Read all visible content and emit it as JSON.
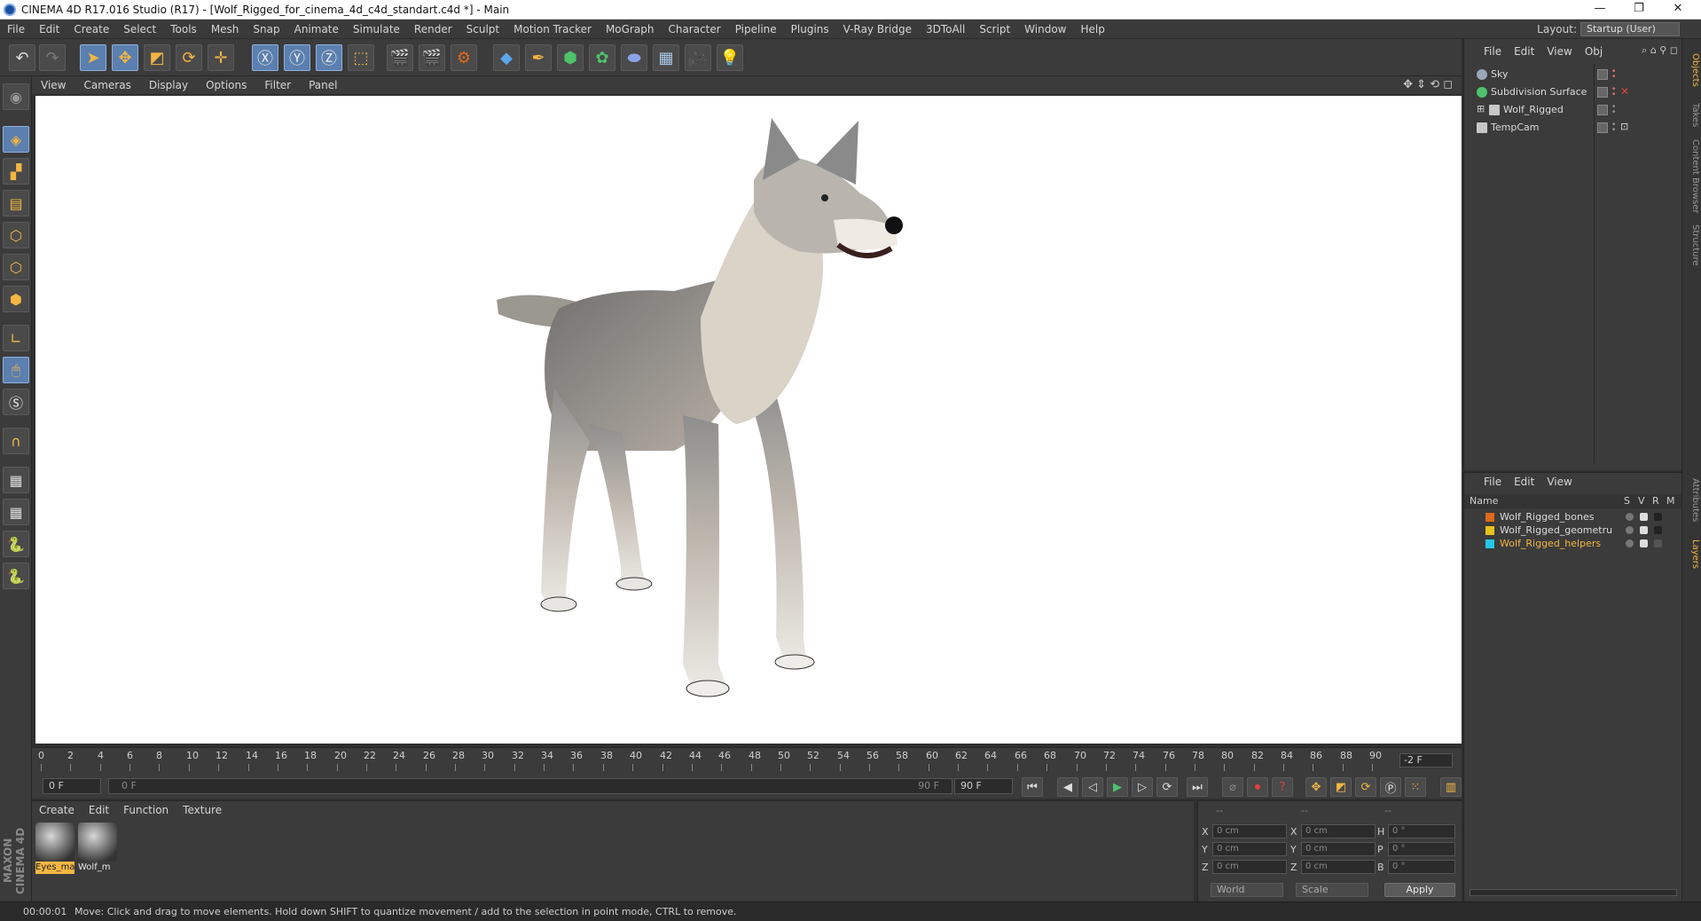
{
  "window": {
    "title": "CINEMA 4D R17.016 Studio (R17) - [Wolf_Rigged_for_cinema_4d_c4d_standart.c4d *] - Main",
    "minimize": "—",
    "restore": "❐",
    "close": "✕"
  },
  "menu": [
    "File",
    "Edit",
    "Create",
    "Select",
    "Tools",
    "Mesh",
    "Snap",
    "Animate",
    "Simulate",
    "Render",
    "Sculpt",
    "Motion Tracker",
    "MoGraph",
    "Character",
    "Pipeline",
    "Plugins",
    "V-Ray Bridge",
    "3DToAll",
    "Script",
    "Window",
    "Help"
  ],
  "layout": {
    "label": "Layout:",
    "value": "Startup (User)"
  },
  "viewport_menu": [
    "View",
    "Cameras",
    "Display",
    "Options",
    "Filter",
    "Panel"
  ],
  "timeline": {
    "ticks": [
      "0",
      "2",
      "4",
      "6",
      "8",
      "10",
      "12",
      "14",
      "16",
      "18",
      "20",
      "22",
      "24",
      "26",
      "28",
      "30",
      "32",
      "34",
      "36",
      "38",
      "40",
      "42",
      "44",
      "46",
      "48",
      "50",
      "52",
      "54",
      "56",
      "58",
      "60",
      "62",
      "64",
      "66",
      "68",
      "70",
      "72",
      "74",
      "76",
      "78",
      "80",
      "82",
      "84",
      "86",
      "88",
      "90"
    ],
    "current_frame": "-2 F",
    "start_field": "0 F",
    "range_start": "0 F",
    "range_end": "90 F",
    "end_field": "90 F"
  },
  "material_menu": [
    "Create",
    "Edit",
    "Function",
    "Texture"
  ],
  "materials": [
    {
      "name": "Eyes_ma",
      "selected": true
    },
    {
      "name": "Wolf_m",
      "selected": false
    }
  ],
  "coords": {
    "headers": [
      "--",
      "--",
      "--"
    ],
    "rows": [
      {
        "a": "X",
        "av": "0 cm",
        "b": "X",
        "bv": "0 cm",
        "c": "H",
        "cv": "0 °"
      },
      {
        "a": "Y",
        "av": "0 cm",
        "b": "Y",
        "bv": "0 cm",
        "c": "P",
        "cv": "0 °"
      },
      {
        "a": "Z",
        "av": "0 cm",
        "b": "Z",
        "bv": "0 cm",
        "c": "B",
        "cv": "0 °"
      }
    ],
    "world": "World",
    "scale": "Scale",
    "apply": "Apply"
  },
  "status": {
    "time": "00:00:01",
    "message": "Move: Click and drag to move elements. Hold down SHIFT to quantize movement / add to the selection in point mode, CTRL to remove."
  },
  "object_menu": [
    "File",
    "Edit",
    "View",
    "Obj"
  ],
  "objects": [
    {
      "name": "Sky",
      "color": "#9aa7b8"
    },
    {
      "name": "Subdivision Surface",
      "color": "#4fc36b"
    },
    {
      "name": "Wolf_Rigged",
      "color": "#c8c8c8"
    },
    {
      "name": "TempCam",
      "color": "#c8c8c8"
    }
  ],
  "layer_menu": [
    "File",
    "Edit",
    "View"
  ],
  "layer_headers": {
    "name": "Name",
    "s": "S",
    "v": "V",
    "r": "R",
    "m": "M"
  },
  "layers": [
    {
      "name": "Wolf_Rigged_bones",
      "color": "#e06a1a",
      "selected": false
    },
    {
      "name": "Wolf_Rigged_geometru",
      "color": "#e8c21a",
      "selected": false
    },
    {
      "name": "Wolf_Rigged_helpers",
      "color": "#25c8e8",
      "selected": true
    }
  ],
  "right_tabs": [
    "Objects",
    "Takes",
    "Content Browser",
    "Structure",
    "Attributes",
    "Layers"
  ],
  "logo": "MAXON CINEMA 4D"
}
